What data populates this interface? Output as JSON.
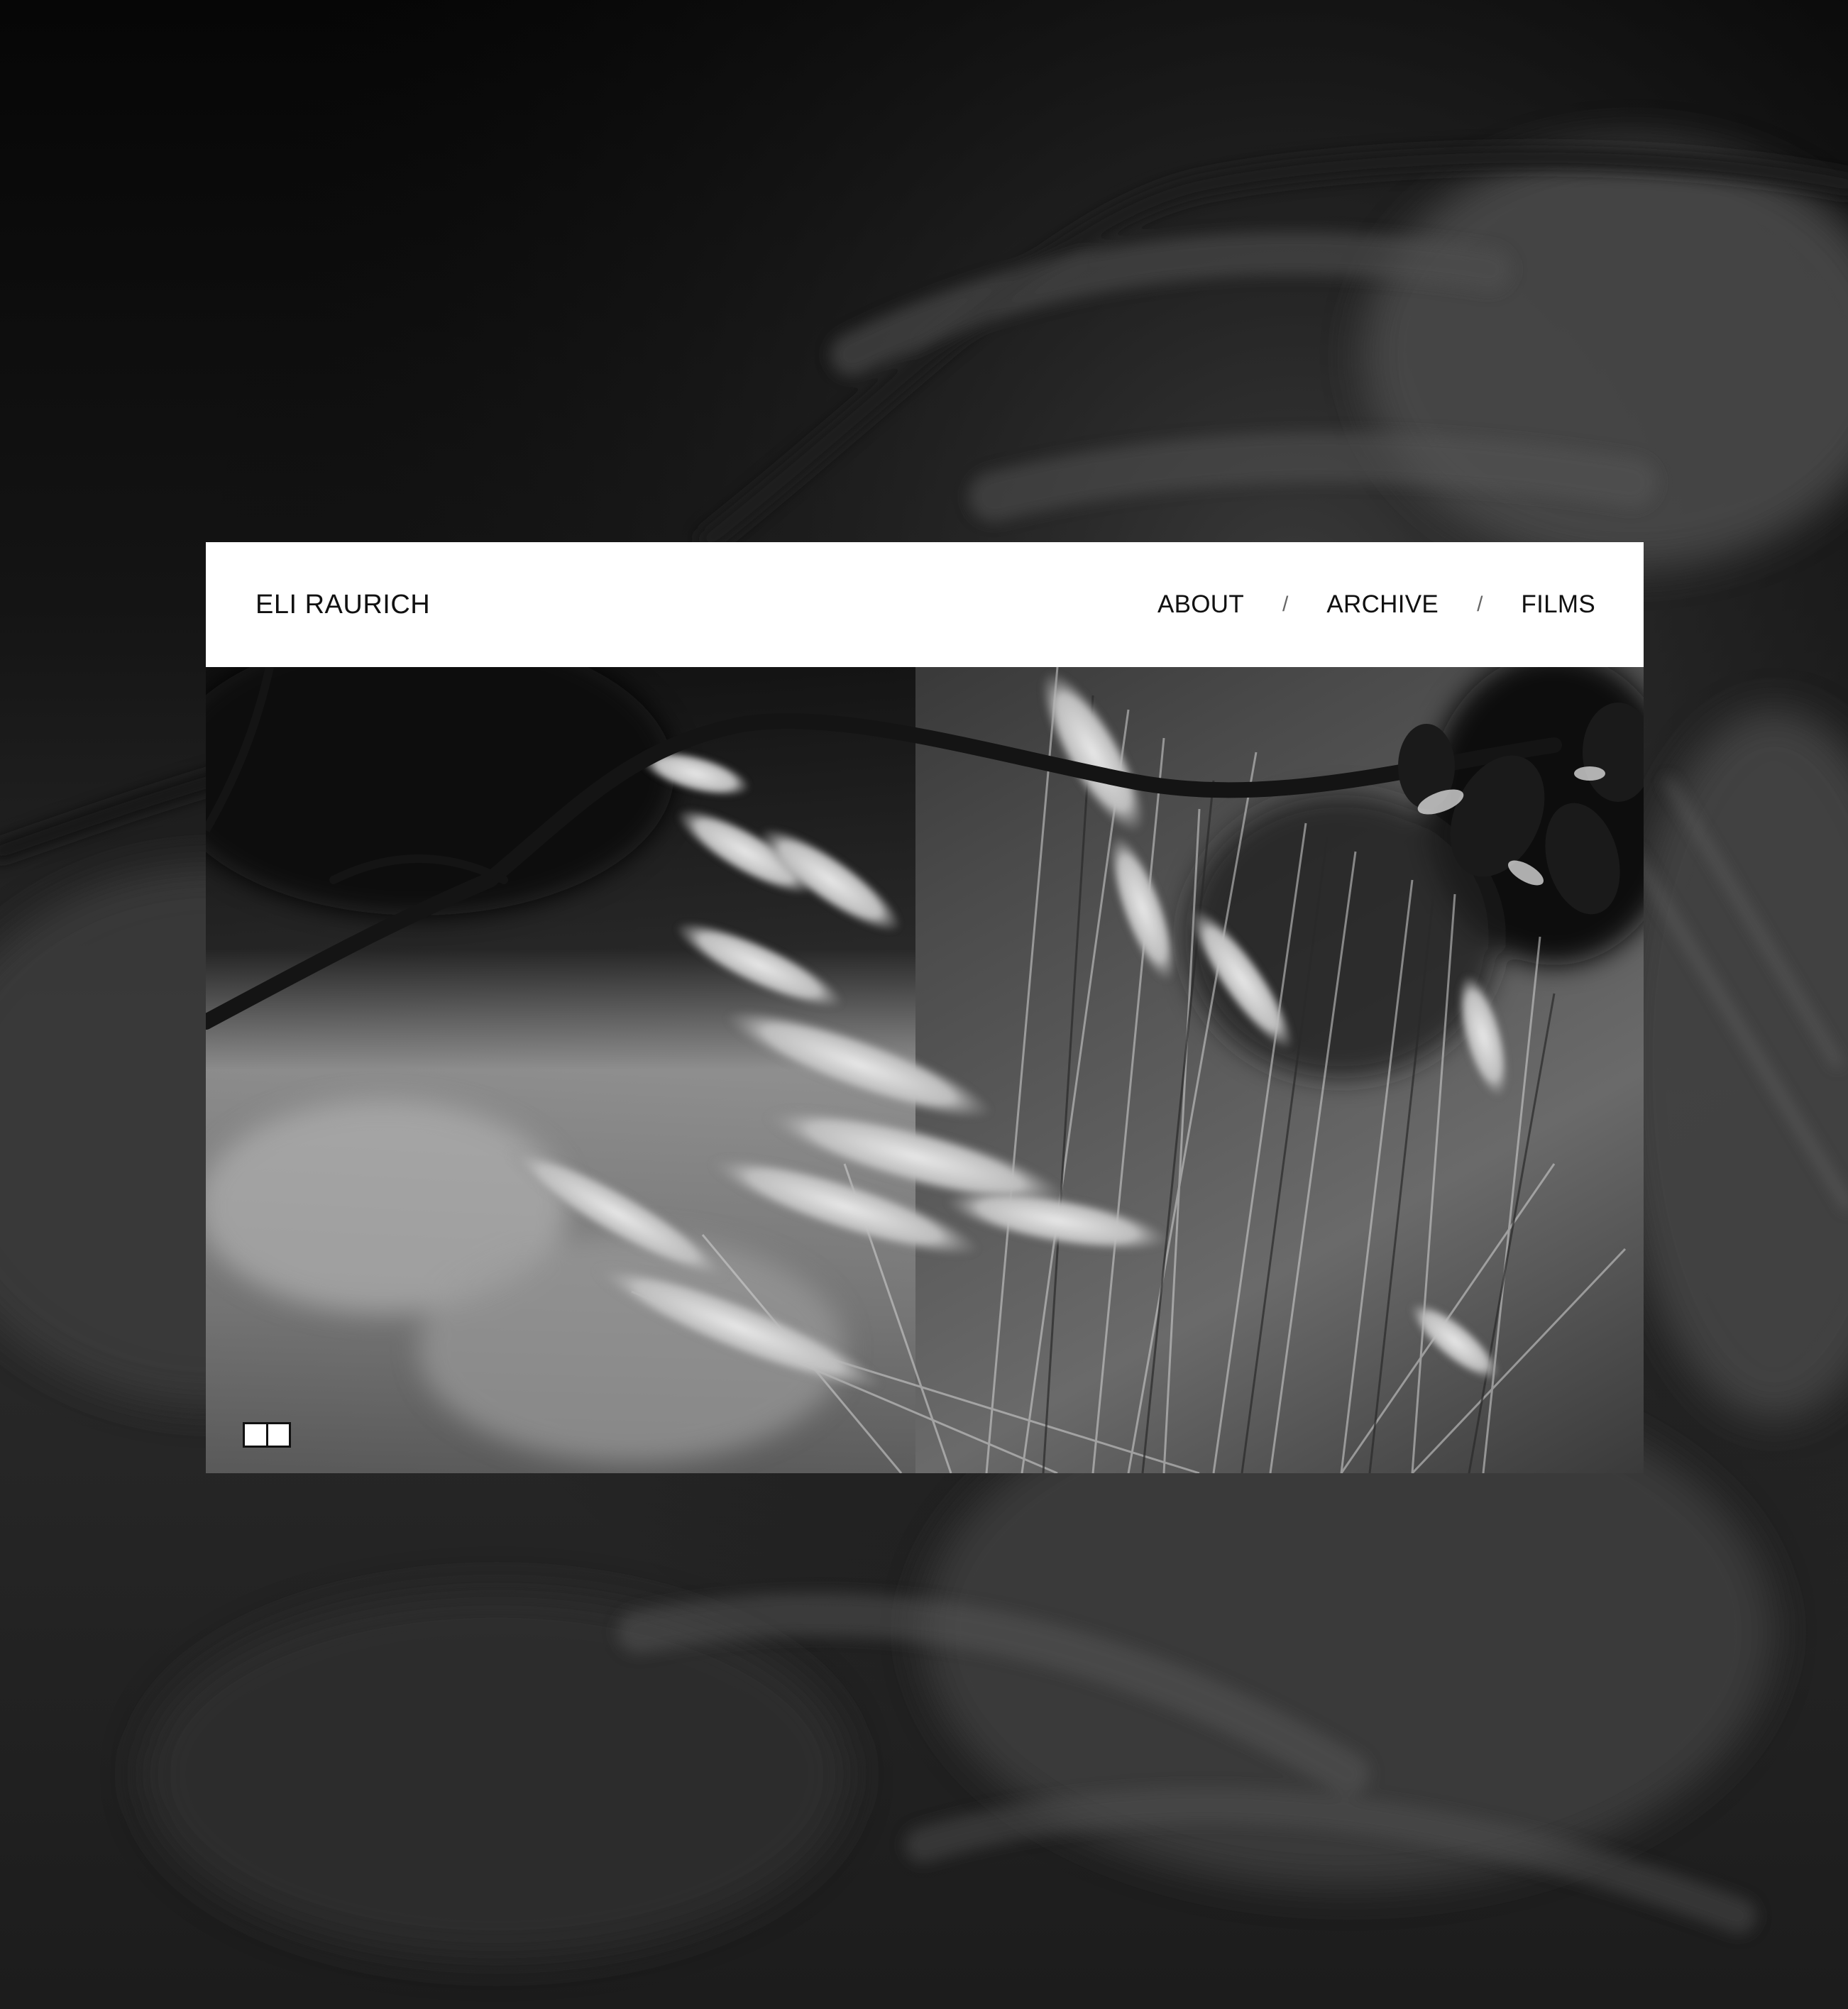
{
  "site": {
    "title": "ELI RAURICH"
  },
  "nav": {
    "items": [
      {
        "label": "ABOUT"
      },
      {
        "label": "ARCHIVE"
      },
      {
        "label": "FILMS"
      }
    ],
    "separator": "/"
  },
  "media": {
    "kind": "video",
    "toggle_icon": "split-view-icon"
  },
  "colors": {
    "header_bg": "#ffffff",
    "text": "#111111",
    "page_bg": "#000000"
  }
}
